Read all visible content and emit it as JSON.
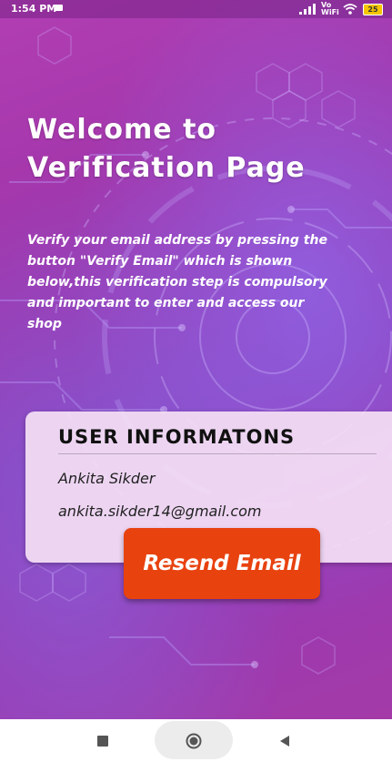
{
  "status_bar": {
    "time": "1:54 PM",
    "network_label": "Vo WiFi",
    "battery_level": "25"
  },
  "page": {
    "title_line1": "Welcome to",
    "title_line2": "Verification Page",
    "description": "Verify your email address by pressing the button \"Verify Email\" which is shown below,this verification step is compulsory and important to enter and access our shop"
  },
  "user_card": {
    "heading": "USER INFORMATONS",
    "name": "Ankita Sikder",
    "email": "ankita.sikder14@gmail.com"
  },
  "actions": {
    "resend_label": "Resend Email"
  },
  "nav": {
    "recent_icon": "square-icon",
    "home_icon": "circle-icon",
    "back_icon": "triangle-back-icon"
  },
  "colors": {
    "button": "#e8420f",
    "background": "#a336ab",
    "card": "#f5e1f5"
  }
}
